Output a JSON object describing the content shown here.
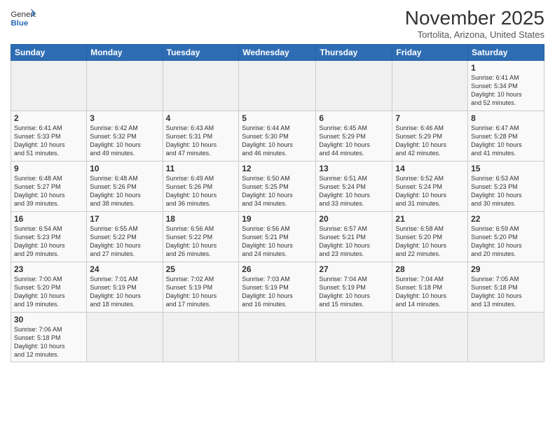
{
  "logo": {
    "text_general": "General",
    "text_blue": "Blue"
  },
  "header": {
    "month_year": "November 2025",
    "location": "Tortolita, Arizona, United States"
  },
  "weekdays": [
    "Sunday",
    "Monday",
    "Tuesday",
    "Wednesday",
    "Thursday",
    "Friday",
    "Saturday"
  ],
  "weeks": [
    [
      {
        "day": "",
        "info": ""
      },
      {
        "day": "",
        "info": ""
      },
      {
        "day": "",
        "info": ""
      },
      {
        "day": "",
        "info": ""
      },
      {
        "day": "",
        "info": ""
      },
      {
        "day": "",
        "info": ""
      },
      {
        "day": "1",
        "info": "Sunrise: 6:41 AM\nSunset: 5:34 PM\nDaylight: 10 hours\nand 52 minutes."
      }
    ],
    [
      {
        "day": "2",
        "info": "Sunrise: 6:41 AM\nSunset: 5:33 PM\nDaylight: 10 hours\nand 51 minutes."
      },
      {
        "day": "3",
        "info": "Sunrise: 6:42 AM\nSunset: 5:32 PM\nDaylight: 10 hours\nand 49 minutes."
      },
      {
        "day": "4",
        "info": "Sunrise: 6:43 AM\nSunset: 5:31 PM\nDaylight: 10 hours\nand 47 minutes."
      },
      {
        "day": "5",
        "info": "Sunrise: 6:44 AM\nSunset: 5:30 PM\nDaylight: 10 hours\nand 46 minutes."
      },
      {
        "day": "6",
        "info": "Sunrise: 6:45 AM\nSunset: 5:29 PM\nDaylight: 10 hours\nand 44 minutes."
      },
      {
        "day": "7",
        "info": "Sunrise: 6:46 AM\nSunset: 5:29 PM\nDaylight: 10 hours\nand 42 minutes."
      },
      {
        "day": "8",
        "info": "Sunrise: 6:47 AM\nSunset: 5:28 PM\nDaylight: 10 hours\nand 41 minutes."
      }
    ],
    [
      {
        "day": "9",
        "info": "Sunrise: 6:48 AM\nSunset: 5:27 PM\nDaylight: 10 hours\nand 39 minutes."
      },
      {
        "day": "10",
        "info": "Sunrise: 6:48 AM\nSunset: 5:26 PM\nDaylight: 10 hours\nand 38 minutes."
      },
      {
        "day": "11",
        "info": "Sunrise: 6:49 AM\nSunset: 5:26 PM\nDaylight: 10 hours\nand 36 minutes."
      },
      {
        "day": "12",
        "info": "Sunrise: 6:50 AM\nSunset: 5:25 PM\nDaylight: 10 hours\nand 34 minutes."
      },
      {
        "day": "13",
        "info": "Sunrise: 6:51 AM\nSunset: 5:24 PM\nDaylight: 10 hours\nand 33 minutes."
      },
      {
        "day": "14",
        "info": "Sunrise: 6:52 AM\nSunset: 5:24 PM\nDaylight: 10 hours\nand 31 minutes."
      },
      {
        "day": "15",
        "info": "Sunrise: 6:53 AM\nSunset: 5:23 PM\nDaylight: 10 hours\nand 30 minutes."
      }
    ],
    [
      {
        "day": "16",
        "info": "Sunrise: 6:54 AM\nSunset: 5:23 PM\nDaylight: 10 hours\nand 29 minutes."
      },
      {
        "day": "17",
        "info": "Sunrise: 6:55 AM\nSunset: 5:22 PM\nDaylight: 10 hours\nand 27 minutes."
      },
      {
        "day": "18",
        "info": "Sunrise: 6:56 AM\nSunset: 5:22 PM\nDaylight: 10 hours\nand 26 minutes."
      },
      {
        "day": "19",
        "info": "Sunrise: 6:56 AM\nSunset: 5:21 PM\nDaylight: 10 hours\nand 24 minutes."
      },
      {
        "day": "20",
        "info": "Sunrise: 6:57 AM\nSunset: 5:21 PM\nDaylight: 10 hours\nand 23 minutes."
      },
      {
        "day": "21",
        "info": "Sunrise: 6:58 AM\nSunset: 5:20 PM\nDaylight: 10 hours\nand 22 minutes."
      },
      {
        "day": "22",
        "info": "Sunrise: 6:59 AM\nSunset: 5:20 PM\nDaylight: 10 hours\nand 20 minutes."
      }
    ],
    [
      {
        "day": "23",
        "info": "Sunrise: 7:00 AM\nSunset: 5:20 PM\nDaylight: 10 hours\nand 19 minutes."
      },
      {
        "day": "24",
        "info": "Sunrise: 7:01 AM\nSunset: 5:19 PM\nDaylight: 10 hours\nand 18 minutes."
      },
      {
        "day": "25",
        "info": "Sunrise: 7:02 AM\nSunset: 5:19 PM\nDaylight: 10 hours\nand 17 minutes."
      },
      {
        "day": "26",
        "info": "Sunrise: 7:03 AM\nSunset: 5:19 PM\nDaylight: 10 hours\nand 16 minutes."
      },
      {
        "day": "27",
        "info": "Sunrise: 7:04 AM\nSunset: 5:19 PM\nDaylight: 10 hours\nand 15 minutes."
      },
      {
        "day": "28",
        "info": "Sunrise: 7:04 AM\nSunset: 5:18 PM\nDaylight: 10 hours\nand 14 minutes."
      },
      {
        "day": "29",
        "info": "Sunrise: 7:05 AM\nSunset: 5:18 PM\nDaylight: 10 hours\nand 13 minutes."
      }
    ],
    [
      {
        "day": "30",
        "info": "Sunrise: 7:06 AM\nSunset: 5:18 PM\nDaylight: 10 hours\nand 12 minutes."
      },
      {
        "day": "",
        "info": ""
      },
      {
        "day": "",
        "info": ""
      },
      {
        "day": "",
        "info": ""
      },
      {
        "day": "",
        "info": ""
      },
      {
        "day": "",
        "info": ""
      },
      {
        "day": "",
        "info": ""
      }
    ]
  ]
}
